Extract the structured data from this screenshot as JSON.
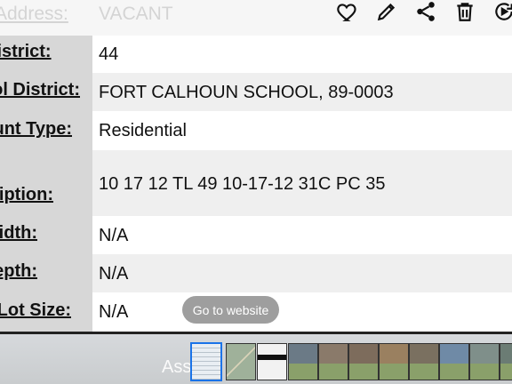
{
  "header": {
    "label": "Address:",
    "value": "VACANT",
    "actions": [
      {
        "name": "favorite-heart-icon"
      },
      {
        "name": "edit-pencil-icon"
      },
      {
        "name": "share-icon"
      },
      {
        "name": "delete-trash-icon"
      },
      {
        "name": "refresh-icon"
      }
    ]
  },
  "rows": [
    {
      "label": "District:",
      "value": "44"
    },
    {
      "label": "School District:",
      "value": "FORT CALHOUN SCHOOL, 89-0003"
    },
    {
      "label": "Account Type:",
      "value": "Residential"
    },
    {
      "label": "Description:",
      "value": "10 17 12 TL 49 10-17-12 31C PC 35"
    },
    {
      "label": "Width:",
      "value": "N/A"
    },
    {
      "label": "Depth:",
      "value": "N/A"
    },
    {
      "label": "Lot Size:",
      "value": "N/A"
    }
  ],
  "toast": {
    "text": "Go to website"
  },
  "footer": {
    "faded_text": "Ass",
    "thumbnails": [
      {
        "name": "document-screenshot",
        "color": "#e9eef3"
      },
      {
        "name": "map",
        "color": "#9fb19a"
      },
      {
        "name": "document-dark",
        "color": "#f2f2f2"
      },
      {
        "name": "house-photo-1",
        "color": "#6b7a86"
      },
      {
        "name": "house-photo-2",
        "color": "#8a7a6a"
      },
      {
        "name": "house-photo-3",
        "color": "#7d6c5c"
      },
      {
        "name": "house-photo-4",
        "color": "#9a8060"
      },
      {
        "name": "house-photo-5",
        "color": "#7a7060"
      },
      {
        "name": "house-photo-6",
        "color": "#6f8aa6"
      },
      {
        "name": "house-photo-7",
        "color": "#7f8f8a"
      },
      {
        "name": "house-photo-8",
        "color": "#6b7c74"
      }
    ]
  },
  "colors": {
    "label_bg": "#d7d7d7",
    "row_alt_bg": "#efefef",
    "toast_bg": "#9e9e9e"
  }
}
